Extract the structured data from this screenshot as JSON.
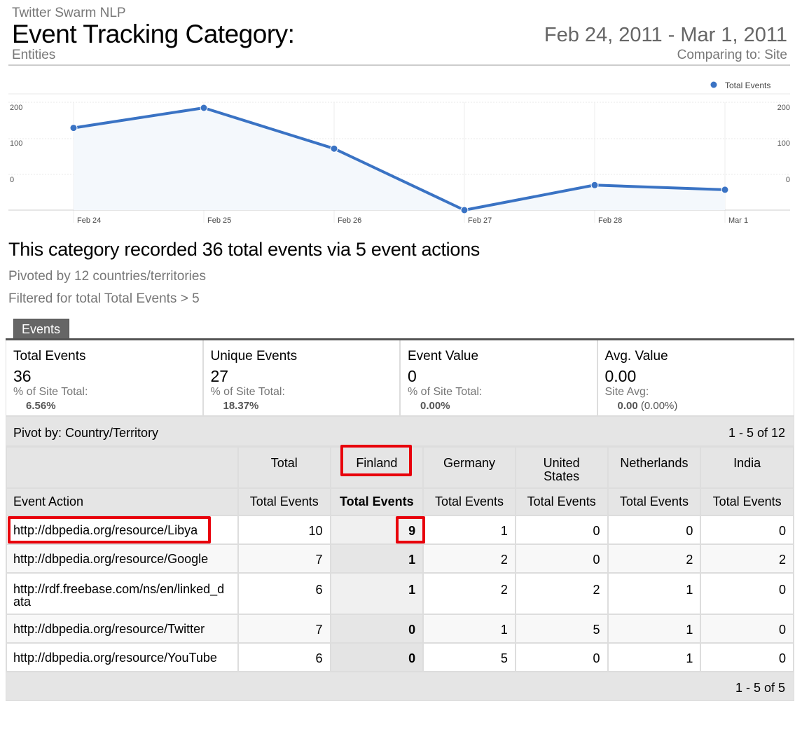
{
  "header": {
    "site_name": "Twitter Swarm NLP",
    "title": "Event Tracking Category:",
    "subtitle": "Entities",
    "date_range": "Feb 24, 2011 - Mar 1, 2011",
    "comparing": "Comparing to: Site"
  },
  "chart_data": {
    "type": "line",
    "categories": [
      "Feb 24",
      "Feb 25",
      "Feb 26",
      "Feb 27",
      "Feb 28",
      "Mar 1"
    ],
    "series": [
      {
        "name": "Total Events",
        "values": [
          230,
          286,
          172,
          0,
          70,
          57
        ],
        "color": "#3a73c4"
      }
    ],
    "y_ticks_left": [
      "200",
      "100",
      "0"
    ],
    "y_ticks_right": [
      "200",
      "100",
      "0"
    ],
    "legend_label": "Total Events",
    "legend_position": "top-right",
    "grid": true,
    "area_fill": "#f4f8fc"
  },
  "summary": {
    "headline": "This category recorded 36 total events via 5 event actions",
    "pivoted": "Pivoted by 12 countries/territories",
    "filtered": "Filtered for total Total Events > 5"
  },
  "tabs": [
    {
      "label": "Events"
    }
  ],
  "metrics": [
    {
      "label": "Total Events",
      "value": "36",
      "pct_label": "% of Site Total:",
      "pct": "6.56%",
      "pct_extra": ""
    },
    {
      "label": "Unique Events",
      "value": "27",
      "pct_label": "% of Site Total:",
      "pct": "18.37%",
      "pct_extra": ""
    },
    {
      "label": "Event Value",
      "value": "0",
      "pct_label": "% of Site Total:",
      "pct": "0.00%",
      "pct_extra": ""
    },
    {
      "label": "Avg. Value",
      "value": "0.00",
      "pct_label": "Site Avg:",
      "pct": "0.00",
      "pct_extra": " (0.00%)"
    }
  ],
  "table": {
    "pivot_label": "Pivot by: Country/Territory",
    "pivot_range": "1 - 5 of 12",
    "footer_range": "1 - 5 of 5",
    "columns": [
      "Total",
      "Finland",
      "Germany",
      "United States",
      "Netherlands",
      "India"
    ],
    "row_header": "Event Action",
    "metric_header": "Total Events",
    "rows": [
      {
        "action": "http://dbpedia.org/resource/Libya",
        "values": [
          "10",
          "9",
          "1",
          "0",
          "0",
          "0"
        ]
      },
      {
        "action": "http://dbpedia.org/resource/Google",
        "values": [
          "7",
          "1",
          "2",
          "0",
          "2",
          "2"
        ]
      },
      {
        "action": "http://rdf.freebase.com/ns/en/linked_data",
        "values": [
          "6",
          "1",
          "2",
          "2",
          "1",
          "0"
        ]
      },
      {
        "action": "http://dbpedia.org/resource/Twitter",
        "values": [
          "7",
          "0",
          "1",
          "5",
          "1",
          "0"
        ]
      },
      {
        "action": "http://dbpedia.org/resource/YouTube",
        "values": [
          "6",
          "0",
          "5",
          "0",
          "1",
          "0"
        ]
      }
    ]
  },
  "colors": {
    "highlight": "#e8000b",
    "series": "#3a73c4"
  }
}
